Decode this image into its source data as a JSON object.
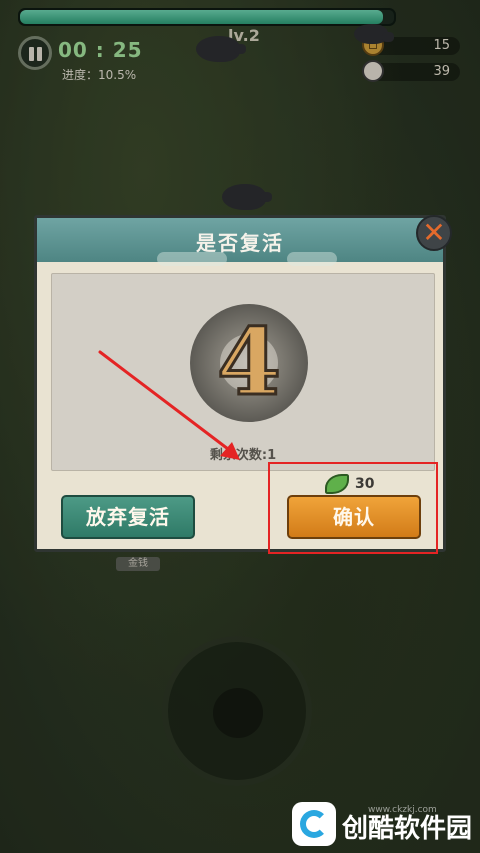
{
  "hud": {
    "hp_fraction": 0.97,
    "timer": "00 : 25",
    "progress_label": "进度：10.5%",
    "level": "lv.2",
    "coins": "15",
    "pigs": "39"
  },
  "dialog": {
    "title": "是否复活",
    "countdown": "4",
    "remaining_label": "剩余次数:1",
    "abandon_label": "放弃复活",
    "confirm_label": "确认",
    "cost": "30",
    "close_symbol": "✕"
  },
  "ground_label": "金钱",
  "watermark": {
    "brand": "创酷软件园",
    "url": "www.ckzkj.com"
  },
  "colors": {
    "accent_teal": "#4e8583",
    "confirm_orange": "#f0a43a",
    "highlight_red": "#e42424"
  },
  "icons": [
    "pause-icon",
    "coin-icon",
    "pig-icon",
    "close-icon",
    "leaf-icon",
    "arrow-annotation"
  ]
}
